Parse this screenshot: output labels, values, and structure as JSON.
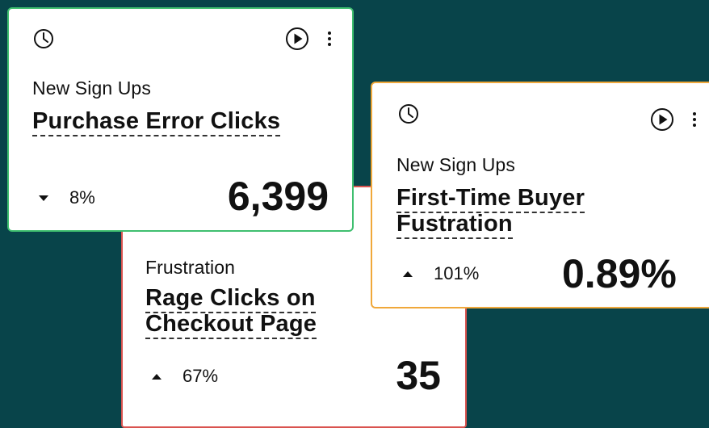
{
  "cards": {
    "purchase": {
      "category": "New Sign Ups",
      "title": "Purchase Error Clicks",
      "trend_direction": "down",
      "trend": "8%",
      "value": "6,399",
      "border_color": "#3fbf6f",
      "icons": [
        "clock-icon",
        "play-icon",
        "more-vertical-icon"
      ]
    },
    "rage": {
      "category": "Frustration",
      "title_line1": "Rage Clicks on",
      "title_line2": "Checkout Page",
      "trend_direction": "up",
      "trend": "67%",
      "value": "35",
      "border_color": "#d9534f"
    },
    "buyer": {
      "category": "New Sign Ups",
      "title_line1": "First-Time Buyer",
      "title_line2": "Fustration",
      "trend_direction": "up",
      "trend": "101%",
      "value": "0.89%",
      "border_color": "#f0a83a",
      "icons": [
        "clock-icon",
        "play-icon",
        "more-vertical-icon"
      ]
    }
  },
  "background_color": "#08444a"
}
